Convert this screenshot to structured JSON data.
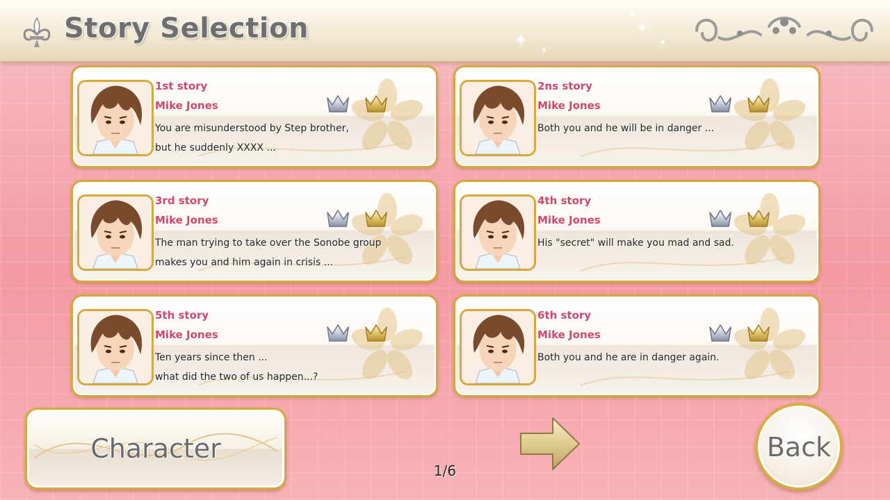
{
  "header": {
    "title": "Story Selection"
  },
  "stories": [
    {
      "title": "1st story",
      "name": "Mike Jones",
      "line1": "You are misunderstood by Step brother,",
      "line2": "but he suddenly XXXX ..."
    },
    {
      "title": "2ns story",
      "name": "Mike Jones",
      "line1": "Both you and he will be in danger ...",
      "line2": ""
    },
    {
      "title": "3rd story",
      "name": "Mike Jones",
      "line1": "The man trying to take over the Sonobe group",
      "line2": "makes you and him again in crisis ..."
    },
    {
      "title": "4th story",
      "name": "Mike Jones",
      "line1": "His \"secret\" will make you mad and sad.",
      "line2": ""
    },
    {
      "title": "5th story",
      "name": "Mike Jones",
      "line1": "Ten years since then ...",
      "line2": "what did the two of us happen...?"
    },
    {
      "title": "6th story",
      "name": "Mike Jones",
      "line1": "Both you and he are in danger again.",
      "line2": ""
    }
  ],
  "footer": {
    "character_label": "Character",
    "page_indicator": "1/6",
    "back_label": "Back"
  },
  "colors": {
    "accent_pink": "#d5456b",
    "gold": "#d4a93a",
    "background": "#f49aa3"
  },
  "icons": [
    "fleur-de-lis-icon",
    "ornament-icon",
    "silver-crown-icon",
    "gold-crown-icon",
    "next-arrow-icon"
  ]
}
